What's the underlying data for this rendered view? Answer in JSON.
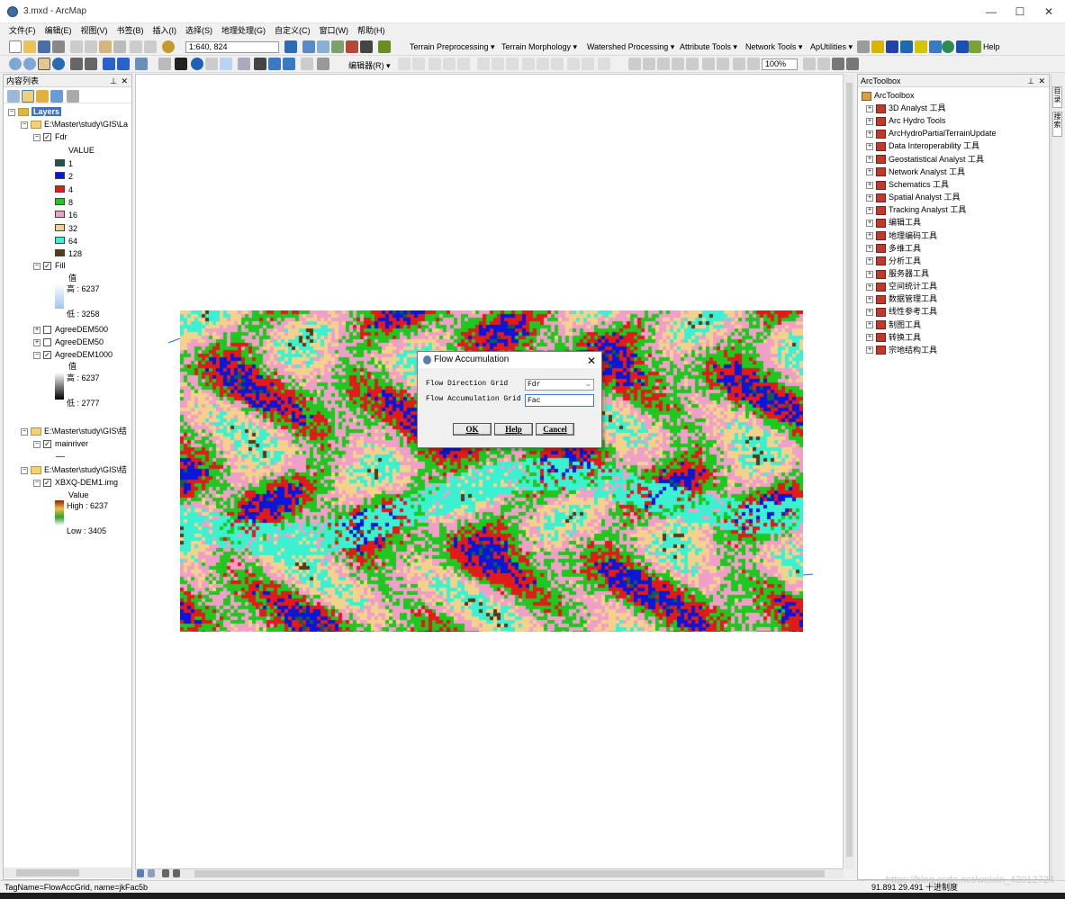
{
  "window": {
    "title": "3.mxd - ArcMap",
    "minimize": "—",
    "maximize": "☐",
    "close": "✕"
  },
  "menu": [
    "文件(F)",
    "编辑(E)",
    "视图(V)",
    "书签(B)",
    "插入(I)",
    "选择(S)",
    "地理处理(G)",
    "自定义(C)",
    "窗口(W)",
    "帮助(H)"
  ],
  "toolbar1": {
    "scale": "1:640, 824",
    "archydro_menus": [
      "Terrain Preprocessing ▾",
      "Terrain Morphology ▾",
      "Watershed Processing ▾",
      "Attribute Tools ▾",
      "Network Tools ▾",
      "ApUtilities ▾"
    ],
    "help": "Help"
  },
  "toolbar2": {
    "editor": "编辑器(R) ▾",
    "zoom": "100%"
  },
  "toc": {
    "title": "内容列表",
    "pin": "⊥",
    "close": "✕",
    "layers_root": "Layers",
    "group1_path": "E:\\Master\\study\\GIS\\La",
    "fdr": {
      "name": "Fdr",
      "field": "VALUE",
      "classes": [
        {
          "label": "1",
          "color": "#17594f"
        },
        {
          "label": "2",
          "color": "#0a17d8"
        },
        {
          "label": "4",
          "color": "#e11a1a"
        },
        {
          "label": "8",
          "color": "#1ec81e"
        },
        {
          "label": "16",
          "color": "#f0a0c8"
        },
        {
          "label": "32",
          "color": "#f5d28c"
        },
        {
          "label": "64",
          "color": "#3cf0d2"
        },
        {
          "label": "128",
          "color": "#5a3a10"
        }
      ]
    },
    "fill": {
      "name": "Fill",
      "field": "值",
      "high": "高 : 6237",
      "low": "低 : 3258"
    },
    "agree500": "AgreeDEM500",
    "agree50": "AgreeDEM50",
    "agree1000": {
      "name": "AgreeDEM1000",
      "field": "值",
      "high": "高 : 6237",
      "low": "低 : 2777"
    },
    "group2_path": "E:\\Master\\study\\GIS\\结",
    "mainriver": "mainriver",
    "group3_path": "E:\\Master\\study\\GIS\\结",
    "xbxq": {
      "name": "XBXQ-DEM1.img",
      "field": "Value",
      "high": "High : 6237",
      "low": "Low : 3405"
    }
  },
  "toolbox": {
    "title": "ArcToolbox",
    "root": "ArcToolbox",
    "items": [
      "3D Analyst 工具",
      "Arc Hydro Tools",
      "ArcHydroPartialTerrainUpdate",
      "Data Interoperability 工具",
      "Geostatistical Analyst 工具",
      "Network Analyst 工具",
      "Schematics 工具",
      "Spatial Analyst 工具",
      "Tracking Analyst 工具",
      "编辑工具",
      "地理编码工具",
      "多维工具",
      "分析工具",
      "服务器工具",
      "空间统计工具",
      "数据管理工具",
      "线性参考工具",
      "制图工具",
      "转换工具",
      "宗地结构工具"
    ]
  },
  "side_tabs": [
    "目录",
    "搜索"
  ],
  "dialog": {
    "title": "Flow Accumulation",
    "fdr_label": "Flow Direction Grid",
    "fdr_value": "Fdr",
    "fac_label": "Flow Accumulation Grid",
    "fac_value": "Fac",
    "ok": "OK",
    "help": "Help",
    "cancel": "Cancel"
  },
  "status": {
    "left": "TagName=FlowAccGrid, name=jkFac5b",
    "coords": "91.891  29.491 十进制度"
  },
  "watermark": "https://blog.csdn.net/weixin_43012724"
}
